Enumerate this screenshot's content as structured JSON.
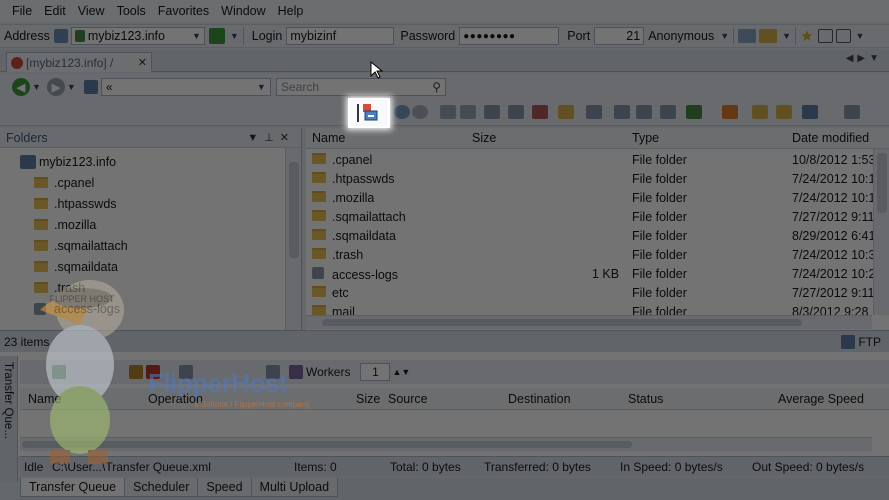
{
  "menu": [
    "File",
    "Edit",
    "View",
    "Tools",
    "Favorites",
    "Window",
    "Help"
  ],
  "address_bar": {
    "address_label": "Address",
    "address_value": "mybiz123.info",
    "login_label": "Login",
    "login_value": "mybizinf",
    "password_label": "Password",
    "password_value": "●●●●●●●●",
    "port_label": "Port",
    "port_value": "21",
    "anonymous_label": "Anonymous"
  },
  "tab": {
    "label": "[mybiz123.info] /"
  },
  "nav": {
    "path": "«",
    "search_placeholder": "Search"
  },
  "folders_pane": {
    "title": "Folders",
    "root": "mybiz123.info",
    "items": [
      ".cpanel",
      ".htpasswds",
      ".mozilla",
      ".sqmailattach",
      ".sqmaildata",
      ".trash",
      "access-logs"
    ]
  },
  "files_pane": {
    "columns": [
      "Name",
      "Size",
      "Type",
      "Date modified"
    ],
    "rows": [
      {
        "name": ".cpanel",
        "size": "",
        "type": "File folder",
        "date": "10/8/2012 1:53"
      },
      {
        "name": ".htpasswds",
        "size": "",
        "type": "File folder",
        "date": "7/24/2012 10:1"
      },
      {
        "name": ".mozilla",
        "size": "",
        "type": "File folder",
        "date": "7/24/2012 10:1"
      },
      {
        "name": ".sqmailattach",
        "size": "",
        "type": "File folder",
        "date": "7/27/2012 9:11"
      },
      {
        "name": ".sqmaildata",
        "size": "",
        "type": "File folder",
        "date": "8/29/2012 6:41"
      },
      {
        "name": ".trash",
        "size": "",
        "type": "File folder",
        "date": "7/24/2012 10:3"
      },
      {
        "name": "access-logs",
        "size": "1 KB",
        "type": "File folder",
        "date": "7/24/2012 10:2"
      },
      {
        "name": "etc",
        "size": "",
        "type": "File folder",
        "date": "7/27/2012 9:11"
      },
      {
        "name": "mail",
        "size": "",
        "type": "File folder",
        "date": "8/3/2012 9:28 F"
      }
    ]
  },
  "status": {
    "items_count": "23 items",
    "protocol": "FTP"
  },
  "queue": {
    "side_label": "Transfer Que...",
    "workers_label": "Workers",
    "workers_value": "1",
    "columns": [
      "Name",
      "Operation",
      "Size",
      "Source",
      "Destination",
      "Status",
      "Average Speed"
    ]
  },
  "queue_status": {
    "state": "Idle",
    "file": "C:\\User...\\Transfer Queue.xml",
    "items": "Items: 0",
    "total": "Total: 0 bytes",
    "transferred": "Transferred: 0 bytes",
    "in_speed": "In Speed: 0 bytes/s",
    "out_speed": "Out Speed: 0 bytes/s"
  },
  "bottom_tabs": [
    "Transfer Queue",
    "Scheduler",
    "Speed",
    "Multi Upload"
  ],
  "watermark": {
    "brand": "FlipperHost",
    "tagline": "a Softorix / FlipperHost company",
    "mascot_text": "FLIPPER HOST"
  }
}
